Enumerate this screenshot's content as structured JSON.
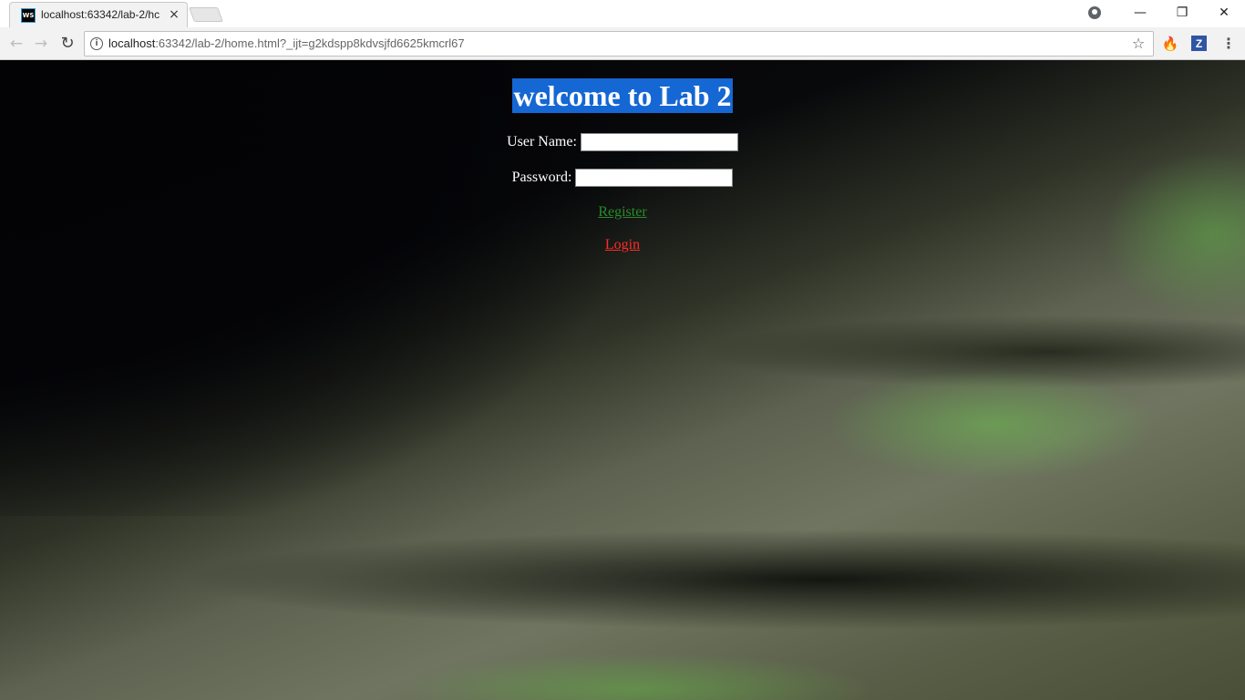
{
  "browser": {
    "tab": {
      "favicon_text": "WS",
      "title": "localhost:63342/lab-2/hc",
      "close": "×"
    },
    "window_controls": {
      "minimize": "—",
      "restore": "❐",
      "close": "✕"
    },
    "nav": {
      "back": "←",
      "forward": "→",
      "reload": "↻"
    },
    "address": {
      "host": "localhost",
      "rest": ":63342/lab-2/home.html?_ijt=g2kdspp8kdvsjfd6625kmcrl67",
      "info_icon": "i",
      "star_icon": "☆"
    },
    "extensions": {
      "fire_icon": "🔥",
      "z_label": "Z",
      "menu_icon": "⋮"
    }
  },
  "page": {
    "heading": "welcome to Lab 2",
    "username_label": "User Name:",
    "username_value": "",
    "password_label": "Password:",
    "password_value": "",
    "register_link": "Register",
    "login_link": "Login"
  },
  "colors": {
    "heading_bg": "#1567d3",
    "register": "#2a8a2a",
    "login": "#ff2a2a"
  }
}
